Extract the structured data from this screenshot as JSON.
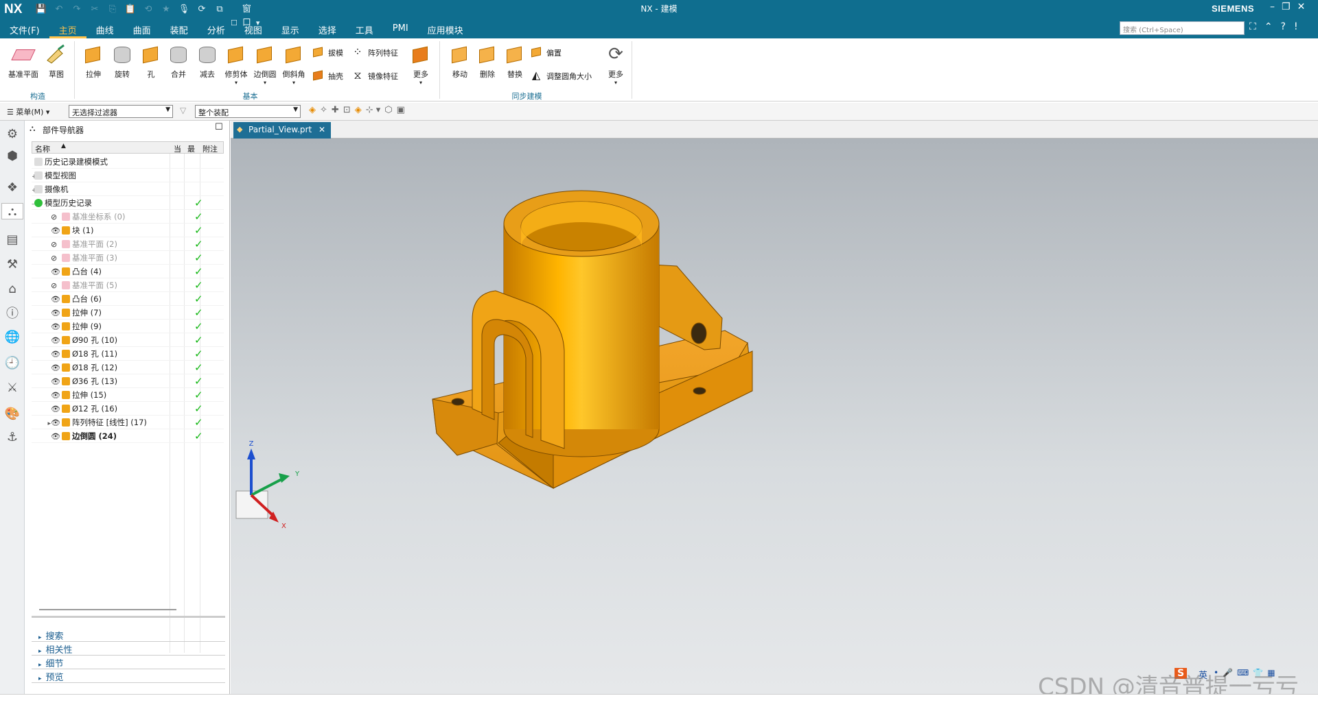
{
  "app": {
    "logo": "NX",
    "title": "NX - 建模",
    "brand": "SIEMENS",
    "window_menu": "窗口"
  },
  "menu_tabs": [
    "文件(F)",
    "主页",
    "曲线",
    "曲面",
    "装配",
    "分析",
    "视图",
    "显示",
    "选择",
    "工具",
    "PMI",
    "应用模块"
  ],
  "active_tab": "主页",
  "search": {
    "placeholder": "搜索 (Ctrl+Space)"
  },
  "ribbon": {
    "groups": {
      "construct": "构造",
      "basic": "基本",
      "sync": "同步建模"
    },
    "construct": [
      "基准平面",
      "草图"
    ],
    "basic": [
      "拉伸",
      "旋转",
      "孔",
      "合并",
      "减去",
      "修剪体",
      "边倒圆",
      "倒斜角"
    ],
    "basic_small": [
      "拔模",
      "阵列特征",
      "抽壳",
      "镜像特征"
    ],
    "basic_more": "更多",
    "sync": [
      "移动",
      "删除",
      "替换"
    ],
    "sync_small": [
      "偏置",
      "调整圆角大小"
    ],
    "sync_more": "更多"
  },
  "filterbar": {
    "menu": "菜单(M)",
    "filter": "无选择过滤器",
    "assembly": "整个装配"
  },
  "navigator": {
    "title": "部件导航器",
    "columns": [
      "名称",
      "当",
      "最",
      "附注"
    ],
    "rows": [
      {
        "label": "历史记录建模模式",
        "state": "normal",
        "check": false,
        "level": 0
      },
      {
        "label": "模型视图",
        "state": "normal",
        "check": false,
        "level": 0
      },
      {
        "label": "摄像机",
        "state": "normal",
        "check": false,
        "level": 0
      },
      {
        "label": "模型历史记录",
        "state": "normal",
        "check": true,
        "level": 0
      },
      {
        "label": "基准坐标系 (0)",
        "state": "gray",
        "check": true,
        "level": 1
      },
      {
        "label": "块 (1)",
        "state": "normal",
        "check": true,
        "level": 1
      },
      {
        "label": "基准平面 (2)",
        "state": "gray",
        "check": true,
        "level": 1
      },
      {
        "label": "基准平面 (3)",
        "state": "gray",
        "check": true,
        "level": 1
      },
      {
        "label": "凸台 (4)",
        "state": "normal",
        "check": true,
        "level": 1
      },
      {
        "label": "基准平面 (5)",
        "state": "gray",
        "check": true,
        "level": 1
      },
      {
        "label": "凸台 (6)",
        "state": "normal",
        "check": true,
        "level": 1
      },
      {
        "label": "拉伸 (7)",
        "state": "normal",
        "check": true,
        "level": 1
      },
      {
        "label": "拉伸 (9)",
        "state": "normal",
        "check": true,
        "level": 1
      },
      {
        "label": "Ø90 孔 (10)",
        "state": "normal",
        "check": true,
        "level": 1
      },
      {
        "label": "Ø18 孔 (11)",
        "state": "normal",
        "check": true,
        "level": 1
      },
      {
        "label": "Ø18 孔 (12)",
        "state": "normal",
        "check": true,
        "level": 1
      },
      {
        "label": "Ø36 孔 (13)",
        "state": "normal",
        "check": true,
        "level": 1
      },
      {
        "label": "拉伸 (15)",
        "state": "normal",
        "check": true,
        "level": 1
      },
      {
        "label": "Ø12 孔 (16)",
        "state": "normal",
        "check": true,
        "level": 1
      },
      {
        "label": "阵列特征 [线性] (17)",
        "state": "normal",
        "check": true,
        "level": 1
      },
      {
        "label": "边倒圆 (24)",
        "state": "bold",
        "check": true,
        "level": 1
      }
    ],
    "sections": [
      "搜索",
      "相关性",
      "细节",
      "预览"
    ]
  },
  "viewport": {
    "tab": "Partial_View.prt",
    "axes": {
      "z": "Z",
      "y": "Y",
      "x": "X"
    }
  },
  "watermark": "CSDN @清音普提一亏亏",
  "ime": "英",
  "colors": {
    "titlebar": "#0f6e8f",
    "accent": "#ffc44d",
    "part": "#f0a416",
    "check": "#14b714"
  }
}
